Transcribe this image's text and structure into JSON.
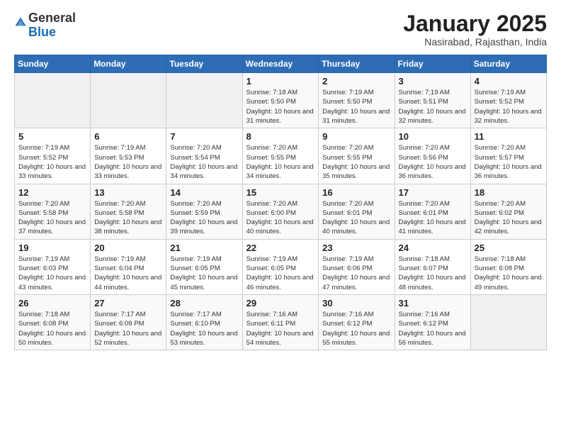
{
  "header": {
    "logo_general": "General",
    "logo_blue": "Blue",
    "month_title": "January 2025",
    "subtitle": "Nasirabad, Rajasthan, India"
  },
  "weekdays": [
    "Sunday",
    "Monday",
    "Tuesday",
    "Wednesday",
    "Thursday",
    "Friday",
    "Saturday"
  ],
  "weeks": [
    [
      {
        "day": "",
        "info": ""
      },
      {
        "day": "",
        "info": ""
      },
      {
        "day": "",
        "info": ""
      },
      {
        "day": "1",
        "info": "Sunrise: 7:18 AM\nSunset: 5:50 PM\nDaylight: 10 hours\nand 31 minutes."
      },
      {
        "day": "2",
        "info": "Sunrise: 7:19 AM\nSunset: 5:50 PM\nDaylight: 10 hours\nand 31 minutes."
      },
      {
        "day": "3",
        "info": "Sunrise: 7:19 AM\nSunset: 5:51 PM\nDaylight: 10 hours\nand 32 minutes."
      },
      {
        "day": "4",
        "info": "Sunrise: 7:19 AM\nSunset: 5:52 PM\nDaylight: 10 hours\nand 32 minutes."
      }
    ],
    [
      {
        "day": "5",
        "info": "Sunrise: 7:19 AM\nSunset: 5:52 PM\nDaylight: 10 hours\nand 33 minutes."
      },
      {
        "day": "6",
        "info": "Sunrise: 7:19 AM\nSunset: 5:53 PM\nDaylight: 10 hours\nand 33 minutes."
      },
      {
        "day": "7",
        "info": "Sunrise: 7:20 AM\nSunset: 5:54 PM\nDaylight: 10 hours\nand 34 minutes."
      },
      {
        "day": "8",
        "info": "Sunrise: 7:20 AM\nSunset: 5:55 PM\nDaylight: 10 hours\nand 34 minutes."
      },
      {
        "day": "9",
        "info": "Sunrise: 7:20 AM\nSunset: 5:55 PM\nDaylight: 10 hours\nand 35 minutes."
      },
      {
        "day": "10",
        "info": "Sunrise: 7:20 AM\nSunset: 5:56 PM\nDaylight: 10 hours\nand 36 minutes."
      },
      {
        "day": "11",
        "info": "Sunrise: 7:20 AM\nSunset: 5:57 PM\nDaylight: 10 hours\nand 36 minutes."
      }
    ],
    [
      {
        "day": "12",
        "info": "Sunrise: 7:20 AM\nSunset: 5:58 PM\nDaylight: 10 hours\nand 37 minutes."
      },
      {
        "day": "13",
        "info": "Sunrise: 7:20 AM\nSunset: 5:58 PM\nDaylight: 10 hours\nand 38 minutes."
      },
      {
        "day": "14",
        "info": "Sunrise: 7:20 AM\nSunset: 5:59 PM\nDaylight: 10 hours\nand 39 minutes."
      },
      {
        "day": "15",
        "info": "Sunrise: 7:20 AM\nSunset: 6:00 PM\nDaylight: 10 hours\nand 40 minutes."
      },
      {
        "day": "16",
        "info": "Sunrise: 7:20 AM\nSunset: 6:01 PM\nDaylight: 10 hours\nand 40 minutes."
      },
      {
        "day": "17",
        "info": "Sunrise: 7:20 AM\nSunset: 6:01 PM\nDaylight: 10 hours\nand 41 minutes."
      },
      {
        "day": "18",
        "info": "Sunrise: 7:20 AM\nSunset: 6:02 PM\nDaylight: 10 hours\nand 42 minutes."
      }
    ],
    [
      {
        "day": "19",
        "info": "Sunrise: 7:19 AM\nSunset: 6:03 PM\nDaylight: 10 hours\nand 43 minutes."
      },
      {
        "day": "20",
        "info": "Sunrise: 7:19 AM\nSunset: 6:04 PM\nDaylight: 10 hours\nand 44 minutes."
      },
      {
        "day": "21",
        "info": "Sunrise: 7:19 AM\nSunset: 6:05 PM\nDaylight: 10 hours\nand 45 minutes."
      },
      {
        "day": "22",
        "info": "Sunrise: 7:19 AM\nSunset: 6:05 PM\nDaylight: 10 hours\nand 46 minutes."
      },
      {
        "day": "23",
        "info": "Sunrise: 7:19 AM\nSunset: 6:06 PM\nDaylight: 10 hours\nand 47 minutes."
      },
      {
        "day": "24",
        "info": "Sunrise: 7:18 AM\nSunset: 6:07 PM\nDaylight: 10 hours\nand 48 minutes."
      },
      {
        "day": "25",
        "info": "Sunrise: 7:18 AM\nSunset: 6:08 PM\nDaylight: 10 hours\nand 49 minutes."
      }
    ],
    [
      {
        "day": "26",
        "info": "Sunrise: 7:18 AM\nSunset: 6:08 PM\nDaylight: 10 hours\nand 50 minutes."
      },
      {
        "day": "27",
        "info": "Sunrise: 7:17 AM\nSunset: 6:09 PM\nDaylight: 10 hours\nand 52 minutes."
      },
      {
        "day": "28",
        "info": "Sunrise: 7:17 AM\nSunset: 6:10 PM\nDaylight: 10 hours\nand 53 minutes."
      },
      {
        "day": "29",
        "info": "Sunrise: 7:16 AM\nSunset: 6:11 PM\nDaylight: 10 hours\nand 54 minutes."
      },
      {
        "day": "30",
        "info": "Sunrise: 7:16 AM\nSunset: 6:12 PM\nDaylight: 10 hours\nand 55 minutes."
      },
      {
        "day": "31",
        "info": "Sunrise: 7:16 AM\nSunset: 6:12 PM\nDaylight: 10 hours\nand 56 minutes."
      },
      {
        "day": "",
        "info": ""
      }
    ]
  ]
}
